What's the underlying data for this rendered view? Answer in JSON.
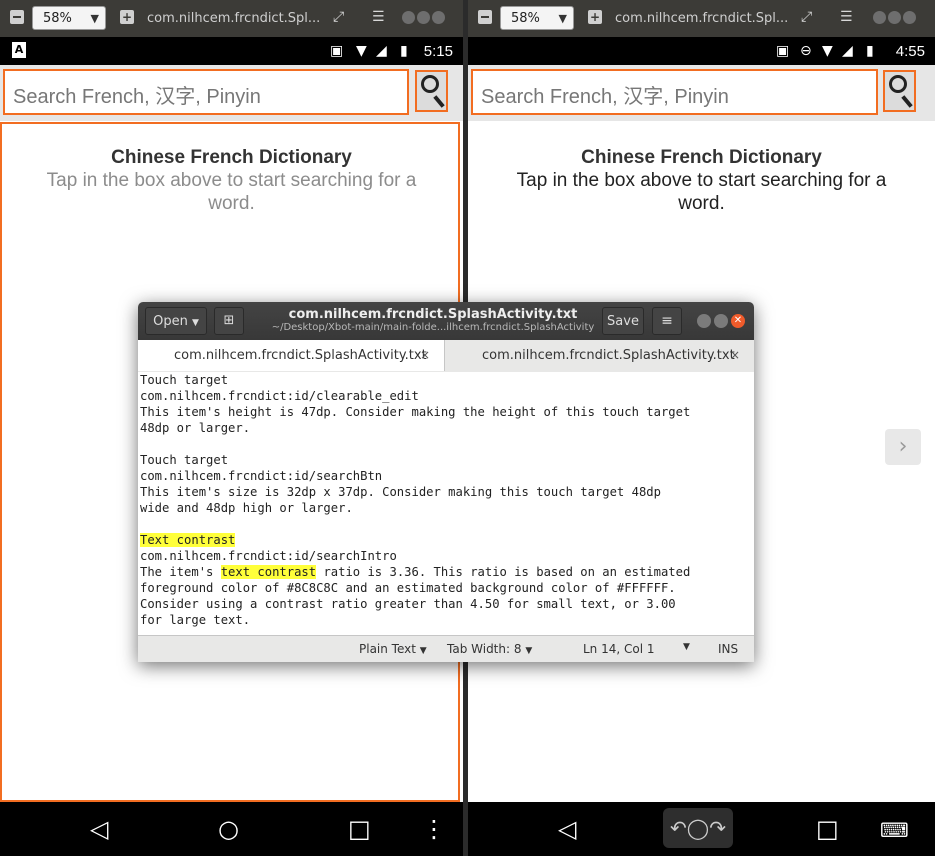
{
  "left": {
    "zoom": "58%",
    "viewer_title": "com.nilhcem.frcndict.Spl...",
    "status_left_icon": "A",
    "time": "5:15",
    "search_placeholder": "Search French, 汉字, Pinyin",
    "intro_title": "Chinese French Dictionary",
    "intro_text": "Tap in the box above to start searching for a word.",
    "intro_color": "#8c8c8c"
  },
  "right": {
    "zoom": "58%",
    "viewer_title": "com.nilhcem.frcndict.Spl...",
    "time": "4:55",
    "search_placeholder": "Search French, 汉字, Pinyin",
    "intro_title": "Chinese French Dictionary",
    "intro_text": "Tap in the box above to start searching for a word.",
    "intro_color": "#222222"
  },
  "gedit": {
    "open_label": "Open",
    "title": "com.nilhcem.frcndict.SplashActivity.txt",
    "subtitle": "~/Desktop/Xbot-main/main-folde...ilhcem.frcndict.SplashActivity",
    "save_label": "Save",
    "tabs": [
      {
        "label": "com.nilhcem.frcndict.SplashActivity.txt"
      },
      {
        "label": "com.nilhcem.frcndict.SplashActivity.txt"
      }
    ],
    "lines": [
      {
        "text": "Touch target"
      },
      {
        "text": "com.nilhcem.frcndict:id/clearable_edit"
      },
      {
        "text": "This item's height is 47dp. Consider making the height of this touch target"
      },
      {
        "text": "48dp or larger."
      },
      {
        "text": ""
      },
      {
        "text": "Touch target"
      },
      {
        "text": "com.nilhcem.frcndict:id/searchBtn"
      },
      {
        "text": "This item's size is 32dp x 37dp. Consider making this touch target 48dp"
      },
      {
        "text": "wide and 48dp high or larger."
      },
      {
        "text": ""
      },
      {
        "text": "Text contrast",
        "highlight_all": true
      },
      {
        "text": "com.nilhcem.frcndict:id/searchIntro"
      },
      {
        "pre": "The item's ",
        "hl": "text contrast",
        "post": " ratio is 3.36. This ratio is based on an estimated"
      },
      {
        "text": "foreground color of #8C8C8C and an estimated background color of #FFFFFF."
      },
      {
        "text": "Consider using a contrast ratio greater than 4.50 for small text, or 3.00"
      },
      {
        "text": "for large text."
      }
    ],
    "status": {
      "syntax": "Plain Text",
      "tab_width": "Tab Width: 8",
      "position": "Ln 14, Col 1",
      "mode": "INS"
    },
    "highlight_color": "#ffff3a"
  },
  "accent_color": "#f26d21"
}
